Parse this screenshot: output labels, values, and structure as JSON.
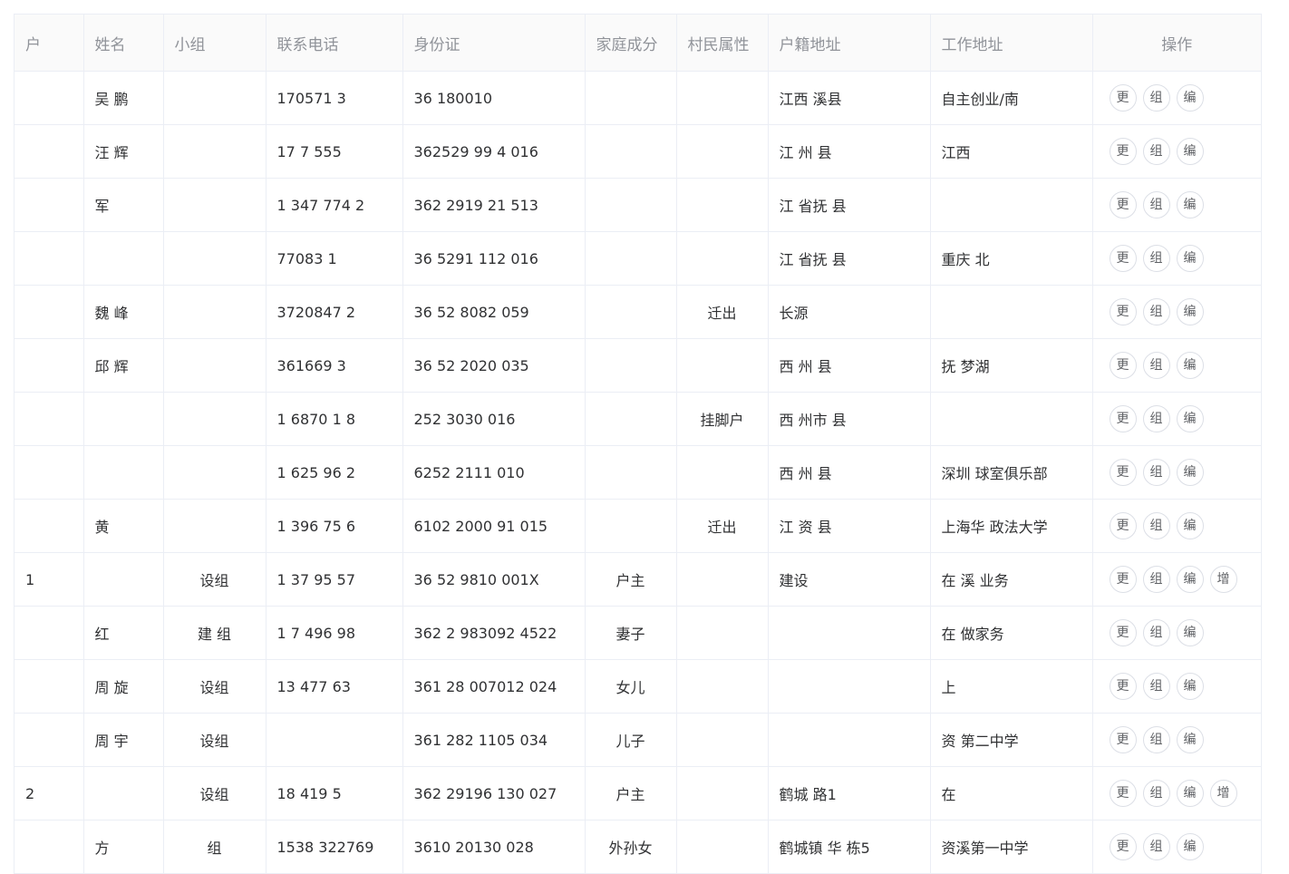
{
  "columns": [
    "户",
    "姓名",
    "小组",
    "联系电话",
    "身份证",
    "家庭成分",
    "村民属性",
    "户籍地址",
    "工作地址",
    "操作"
  ],
  "op_labels": {
    "more": "更",
    "group": "组",
    "edit": "编",
    "add": "增"
  },
  "rows": [
    {
      "hu": "",
      "name": "吴 鹏",
      "group": "",
      "phone": "170571 3",
      "id": "36 180010",
      "family": "",
      "attr": "",
      "address": "江西 溪县",
      "work": "自主创业/南",
      "add": false
    },
    {
      "hu": "",
      "name": "汪 辉",
      "group": "",
      "phone": "17 7 555",
      "id": "362529 99 4 016",
      "family": "",
      "attr": "",
      "address": "江 州 县",
      "work": "江西",
      "add": false
    },
    {
      "hu": "",
      "name": "军",
      "group": "",
      "phone": "1 347 774 2",
      "id": "362 2919 21 513",
      "family": "",
      "attr": "",
      "address": "江 省抚 县",
      "work": "",
      "add": false
    },
    {
      "hu": "",
      "name": "",
      "group": "",
      "phone": "77083 1",
      "id": "36 5291 112 016",
      "family": "",
      "attr": "",
      "address": "江 省抚 县",
      "work": "重庆 北",
      "add": false
    },
    {
      "hu": "",
      "name": "魏 峰",
      "group": "",
      "phone": "3720847 2",
      "id": "36 52 8082 059",
      "family": "",
      "attr": "迁出",
      "address": "长源",
      "work": "",
      "add": false
    },
    {
      "hu": "",
      "name": "邱 辉",
      "group": "",
      "phone": "361669 3",
      "id": "36 52 2020 035",
      "family": "",
      "attr": "",
      "address": "西 州 县",
      "work": "抚 梦湖",
      "add": false
    },
    {
      "hu": "",
      "name": "",
      "group": "",
      "phone": "1 6870 1 8",
      "id": "252 3030 016",
      "family": "",
      "attr": "挂脚户",
      "address": "西 州市 县",
      "work": "",
      "add": false
    },
    {
      "hu": "",
      "name": "",
      "group": "",
      "phone": "1 625 96 2",
      "id": "6252 2111 010",
      "family": "",
      "attr": "",
      "address": "西 州 县",
      "work": "深圳 球室俱乐部",
      "add": false
    },
    {
      "hu": "",
      "name": "黄",
      "group": "",
      "phone": "1 396 75 6",
      "id": "6102 2000 91 015",
      "family": "",
      "attr": "迁出",
      "address": "江 资 县",
      "work": "上海华 政法大学",
      "add": false
    },
    {
      "hu": "1",
      "name": "",
      "group": "设组",
      "phone": "1 37 95 57",
      "id": "36 52 9810 001X",
      "family": "户主",
      "attr": "",
      "address": "建设",
      "work": "在 溪 业务",
      "add": true
    },
    {
      "hu": "",
      "name": "红",
      "group": "建 组",
      "phone": "1 7 496 98",
      "id": "362 2 983092 4522",
      "family": "妻子",
      "attr": "",
      "address": "",
      "work": "在 做家务",
      "add": false
    },
    {
      "hu": "",
      "name": "周 旋",
      "group": "设组",
      "phone": "13 477 63",
      "id": "361 28 007012 024",
      "family": "女儿",
      "attr": "",
      "address": "",
      "work": "上",
      "add": false
    },
    {
      "hu": "",
      "name": "周 宇",
      "group": "设组",
      "phone": "",
      "id": "361 282 1105 034",
      "family": "儿子",
      "attr": "",
      "address": "",
      "work": "资 第二中学",
      "add": false
    },
    {
      "hu": "2",
      "name": "",
      "group": "设组",
      "phone": "18 419 5",
      "id": "362 29196 130 027",
      "family": "户主",
      "attr": "",
      "address": "鹤城 路1",
      "work": "在",
      "add": true
    },
    {
      "hu": "",
      "name": "方",
      "group": "组",
      "phone": "1538 322769",
      "id": "3610 20130 028",
      "family": "外孙女",
      "attr": "",
      "address": "鹤城镇 华 栋5",
      "work": "资溪第一中学",
      "add": false
    }
  ]
}
